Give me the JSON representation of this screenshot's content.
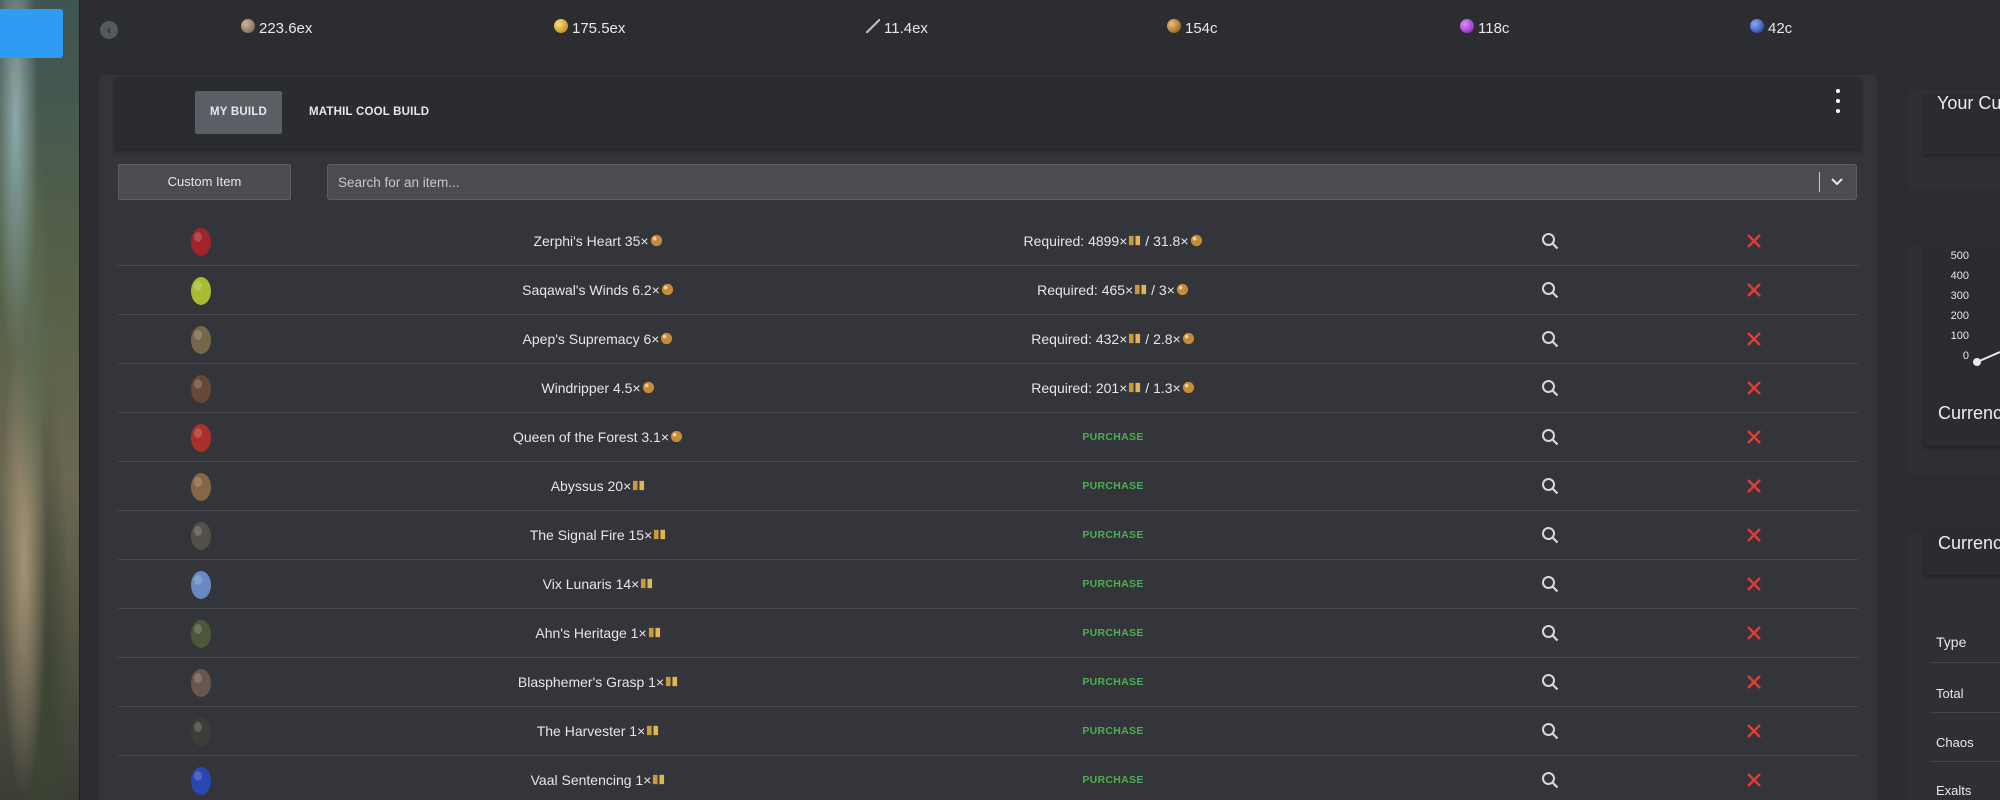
{
  "currency_bar": [
    {
      "icon": "divine-orb-icon",
      "value": "223.6ex",
      "color": "#8a7a63"
    },
    {
      "icon": "gold-orb-icon",
      "value": "175.5ex",
      "color": "#d9a431"
    },
    {
      "icon": "wand-icon",
      "value": "11.4ex",
      "color": "#b8b8b8"
    },
    {
      "icon": "exalted-orb-icon",
      "value": "154c",
      "color": "#c58a3a"
    },
    {
      "icon": "purple-orb-icon",
      "value": "118c",
      "color": "#a23fd6"
    },
    {
      "icon": "blue-orb-icon",
      "value": "42c",
      "color": "#2f56c8"
    }
  ],
  "tabs": [
    {
      "label": "MY BUILD",
      "active": true
    },
    {
      "label": "MATHIL COOL BUILD",
      "active": false
    }
  ],
  "custom_item_label": "Custom Item",
  "search": {
    "placeholder": "Search for an item..."
  },
  "purchase_label": "PURCHASE",
  "items": [
    {
      "name": "Zerphi's Heart 35×",
      "req_text": "Required: 4899×",
      "req_mid": " / 31.8×",
      "status": "required",
      "icon": "ruby-heart-icon",
      "icon_color": "#a8242a"
    },
    {
      "name": "Saqawal's Winds 6.2×",
      "req_text": "Required: 465×",
      "req_mid": " / 3×",
      "status": "required",
      "icon": "winds-armour-icon",
      "icon_color": "#b0c430"
    },
    {
      "name": "Apep's Supremacy 6×",
      "req_text": "Required: 432×",
      "req_mid": " / 2.8×",
      "status": "required",
      "icon": "serpent-armour-icon",
      "icon_color": "#7a6a4a"
    },
    {
      "name": "Windripper 4.5×",
      "req_text": "Required: 201×",
      "req_mid": " / 1.3×",
      "status": "required",
      "icon": "bow-icon",
      "icon_color": "#6a4a36"
    },
    {
      "name": "Queen of the Forest 3.1×",
      "status": "purchase",
      "icon": "forest-armour-icon",
      "icon_color": "#b03028"
    },
    {
      "name": "Abyssus 20×",
      "status": "purchase",
      "icon": "helmet-icon",
      "icon_color": "#8a6a46"
    },
    {
      "name": "The Signal Fire 15×",
      "status": "purchase",
      "icon": "staff-icon",
      "icon_color": "#55514a"
    },
    {
      "name": "Vix Lunaris 14×",
      "status": "purchase",
      "icon": "shield-icon",
      "icon_color": "#6a90c8"
    },
    {
      "name": "Ahn's Heritage 1×",
      "status": "purchase",
      "icon": "tower-shield-icon",
      "icon_color": "#4e5a3a"
    },
    {
      "name": "Blasphemer's Grasp 1×",
      "status": "purchase",
      "icon": "gloves-icon",
      "icon_color": "#6a5a50"
    },
    {
      "name": "The Harvester 1×",
      "status": "purchase",
      "icon": "axe-icon",
      "icon_color": "#3e3e3a"
    },
    {
      "name": "Vaal Sentencing 1×",
      "status": "purchase",
      "icon": "vaal-ring-icon",
      "icon_color": "#2a48b8"
    }
  ],
  "right_panel": {
    "top_title": "Your Cu",
    "chart_yticks": [
      "500",
      "400",
      "300",
      "200",
      "100",
      "0"
    ],
    "chart_title": "Currenc",
    "table_title": "Currenc",
    "table_rows": [
      "Type",
      "Total",
      "Chaos",
      "Exalts"
    ]
  },
  "colors": {
    "purchase": "#4caf50",
    "delete": "#e53935",
    "accent": "#2f9bf2"
  }
}
